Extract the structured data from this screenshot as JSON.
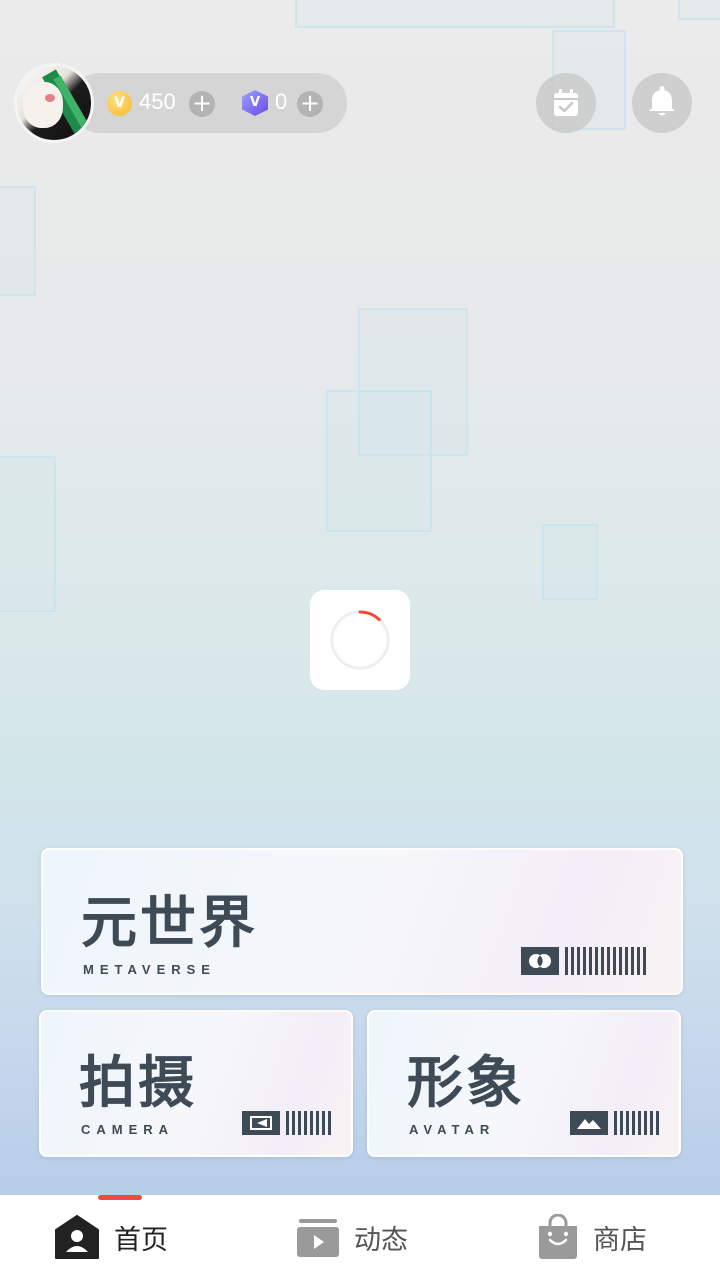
{
  "header": {
    "coins": "450",
    "coin_symbol": "V",
    "gems": "0",
    "gem_symbol": "V",
    "add_symbol": "+"
  },
  "loader": {
    "progress": 0.12
  },
  "cards": {
    "metaverse": {
      "title": "元世界",
      "subtitle": "METAVERSE"
    },
    "camera": {
      "title": "拍摄",
      "subtitle": "CAMERA"
    },
    "avatar": {
      "title": "形象",
      "subtitle": "AVATAR"
    }
  },
  "tabs": [
    {
      "label": "首页",
      "icon": "home-person-icon",
      "active": true
    },
    {
      "label": "动态",
      "icon": "video-feed-icon",
      "active": false
    },
    {
      "label": "商店",
      "icon": "shopping-bag-icon",
      "active": false
    }
  ],
  "colors": {
    "accent": "#f04a3c",
    "card_text": "#3e4a56",
    "active_tab": "#222222",
    "inactive_tab": "#555555"
  }
}
